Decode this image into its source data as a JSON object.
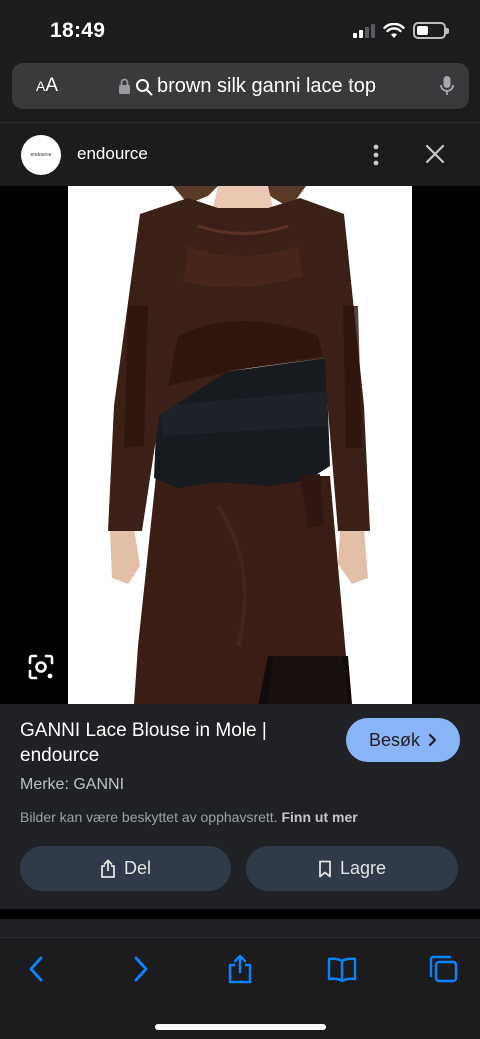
{
  "status": {
    "time": "18:49"
  },
  "address_bar": {
    "aa_label_small": "A",
    "aa_label_large": "A",
    "query": "brown silk ganni lace top"
  },
  "site": {
    "logo_text": "endource",
    "name": "endource"
  },
  "product": {
    "title": "GANNI Lace Blouse in Mole | endource",
    "visit_label": "Besøk",
    "brand_line": "Merke: GANNI",
    "copyright_text": "Bilder kan være beskyttet av opphavsrett.",
    "copyright_link": "Finn ut mer",
    "share_label": "Del",
    "save_label": "Lagre"
  },
  "icons": {
    "lock": "lock-icon",
    "search": "search-icon",
    "mic": "microphone-icon",
    "more": "more-vertical-icon",
    "close": "close-icon",
    "lens": "google-lens-icon",
    "share": "share-icon",
    "bookmark": "bookmark-icon",
    "back": "back-icon",
    "forward": "forward-icon",
    "tabs": "tabs-icon",
    "bookmarks": "book-icon"
  },
  "colors": {
    "accent": "#8ab4f8",
    "toolbar_icon": "#0a84ff",
    "panel": "#202124"
  }
}
